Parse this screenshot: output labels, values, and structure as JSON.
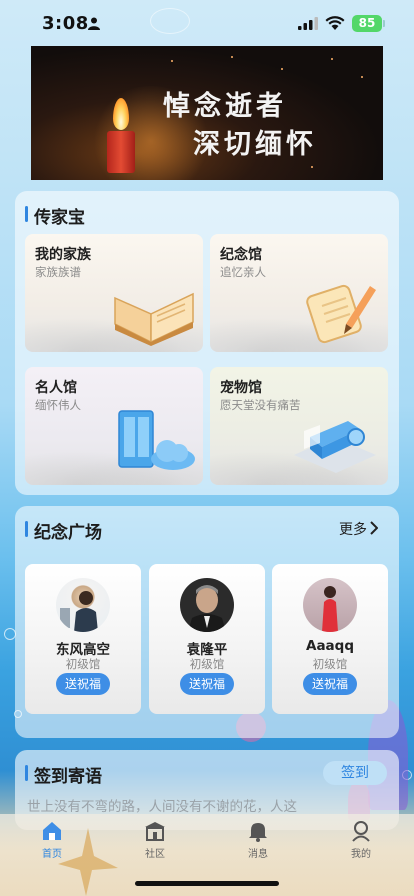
{
  "status_bar": {
    "time": "3:08",
    "battery": "85"
  },
  "banner": {
    "line1": "悼念逝者",
    "line2": "深切缅怀"
  },
  "heritage": {
    "title": "传家宝",
    "tiles": [
      {
        "title": "我的家族",
        "subtitle": "家族族谱",
        "icon": "open-book-icon"
      },
      {
        "title": "纪念馆",
        "subtitle": "追忆亲人",
        "icon": "notepad-pencil-icon"
      },
      {
        "title": "名人馆",
        "subtitle": "缅怀伟人",
        "icon": "cabinet-cloud-icon"
      },
      {
        "title": "宠物馆",
        "subtitle": "愿天堂没有痛苦",
        "icon": "projector-icon"
      }
    ]
  },
  "plaza": {
    "title": "纪念广场",
    "more": "更多",
    "people": [
      {
        "name": "东风高空",
        "level": "初级馆",
        "button": "送祝福"
      },
      {
        "name": "袁隆平",
        "level": "初级馆",
        "button": "送祝福"
      },
      {
        "name": "Aaaqq",
        "level": "初级馆",
        "button": "送祝福"
      }
    ]
  },
  "checkin": {
    "title": "签到寄语",
    "button": "签到",
    "verse": "世上没有不弯的路，人间没有不谢的花，人这"
  },
  "tabbar": {
    "items": [
      {
        "label": "首页",
        "icon": "home-icon",
        "active": true
      },
      {
        "label": "社区",
        "icon": "community-icon",
        "active": false
      },
      {
        "label": "消息",
        "icon": "bell-icon",
        "active": false
      },
      {
        "label": "我的",
        "icon": "profile-icon",
        "active": false
      }
    ]
  },
  "colors": {
    "accent": "#2f86e0",
    "button": "#3e8ee6",
    "battery": "#53d769"
  }
}
